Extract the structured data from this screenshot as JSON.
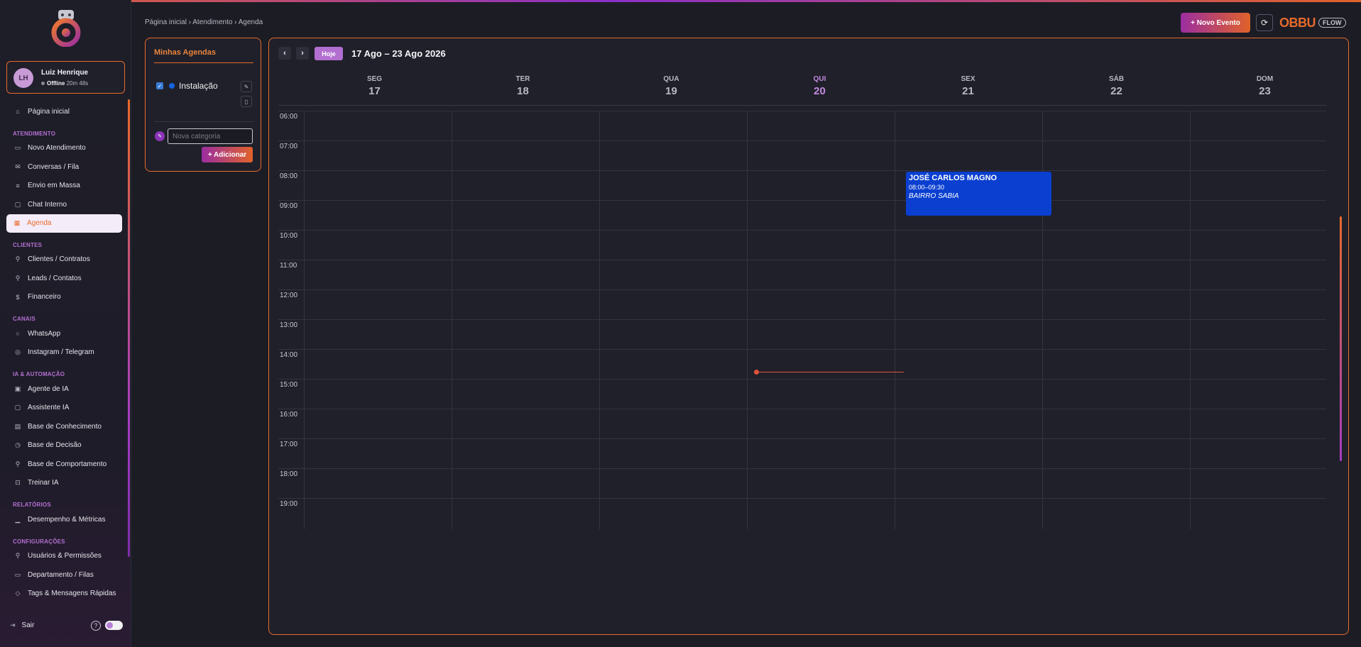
{
  "breadcrumb": "Página inicial › Atendimento › Agenda",
  "brand": {
    "name": "OBBU",
    "tag": "FLOW"
  },
  "header": {
    "new_event_label": "+ Novo Evento",
    "refresh_icon": "refresh-icon"
  },
  "user": {
    "initials": "LH",
    "name": "Luiz Henrique",
    "status": "Offline",
    "elapsed": "20m 48s"
  },
  "sidebar": {
    "home": "Página inicial",
    "sections": [
      {
        "title": "ATENDIMENTO",
        "items": [
          "Novo Atendimento",
          "Conversas / Fila",
          "Envio em Massa",
          "Chat Interno",
          "Agenda"
        ]
      },
      {
        "title": "CLIENTES",
        "items": [
          "Clientes / Contratos",
          "Leads / Contatos",
          "Financeiro"
        ]
      },
      {
        "title": "CANAIS",
        "items": [
          "WhatsApp",
          "Instagram / Telegram"
        ]
      },
      {
        "title": "IA & AUTOMAÇÃO",
        "items": [
          "Agente de IA",
          "Assistente IA",
          "Base de Conhecimento",
          "Base de Decisão",
          "Base de Comportamento",
          "Treinar IA"
        ]
      },
      {
        "title": "RELATÓRIOS",
        "items": [
          "Desempenho & Métricas"
        ]
      },
      {
        "title": "CONFIGURAÇÕES",
        "items": [
          "Usuários & Permissões",
          "Departamento / Filas",
          "Tags & Mensagens Rápidas"
        ]
      }
    ],
    "active_item": "Agenda",
    "logout": "Sair"
  },
  "agendas": {
    "title": "Minhas Agendas",
    "items": [
      {
        "label": "Instalação",
        "color": "#1565e0",
        "checked": true
      }
    ],
    "new_category_placeholder": "Nova categoria",
    "add_label": "+ Adicionar"
  },
  "calendar": {
    "today_label": "Hoje",
    "range": "17 Ago – 23 Ago 2026",
    "days": [
      {
        "name": "SEG",
        "num": "17"
      },
      {
        "name": "TER",
        "num": "18"
      },
      {
        "name": "QUA",
        "num": "19"
      },
      {
        "name": "QUI",
        "num": "20",
        "today": true
      },
      {
        "name": "SEX",
        "num": "21"
      },
      {
        "name": "SÁB",
        "num": "22"
      },
      {
        "name": "DOM",
        "num": "23"
      }
    ],
    "hours": [
      "06:00",
      "07:00",
      "08:00",
      "09:00",
      "10:00",
      "11:00",
      "12:00",
      "13:00",
      "14:00",
      "15:00",
      "16:00",
      "17:00",
      "18:00",
      "19:00"
    ],
    "events": [
      {
        "title": "JOSÉ CARLOS MAGNO",
        "time": "08:00–09:30",
        "place": "BAIRRO SABIA",
        "day": "SEX",
        "color": "#0a3fd0"
      }
    ],
    "accent": "#e86a2a"
  }
}
